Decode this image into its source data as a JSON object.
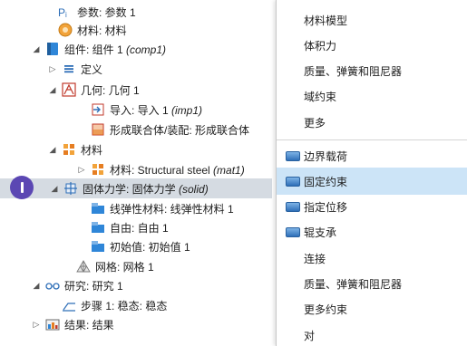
{
  "tree": {
    "params": "参数: 参数 1",
    "materials_top": "材料: 材料",
    "component": "组件: 组件 1 ",
    "component_tag": "(comp1)",
    "definitions": "定义",
    "geometry": "几何: 几何 1",
    "import": "导入: 导入 1 ",
    "import_tag": "(imp1)",
    "form_union": "形成联合体/装配: 形成联合体",
    "materials": "材料",
    "material_item": "材料: Structural steel ",
    "material_item_tag": "(mat1)",
    "solid": "固体力学: 固体力学 ",
    "solid_tag": "(solid)",
    "linear_elastic": "线弹性材料: 线弹性材料 1",
    "free": "自由: 自由 1",
    "initial_values": "初始值: 初始值 1",
    "mesh": "网格: 网格 1",
    "study": "研究: 研究 1",
    "step": "步骤 1: 稳态: 稳态",
    "results": "结果: 结果"
  },
  "menu": {
    "items": [
      "材料模型",
      "体积力",
      "质量、弹簧和阻尼器",
      "域约束",
      "更多",
      "边界载荷",
      "固定约束",
      "指定位移",
      "辊支承",
      "连接",
      "质量、弹簧和阻尼器",
      "更多约束",
      "对"
    ],
    "highlighted": "固定约束"
  },
  "colors": {
    "accent": "#5b47b3",
    "selection": "#d5dbe2",
    "menu_highlight": "#cce4f7"
  }
}
